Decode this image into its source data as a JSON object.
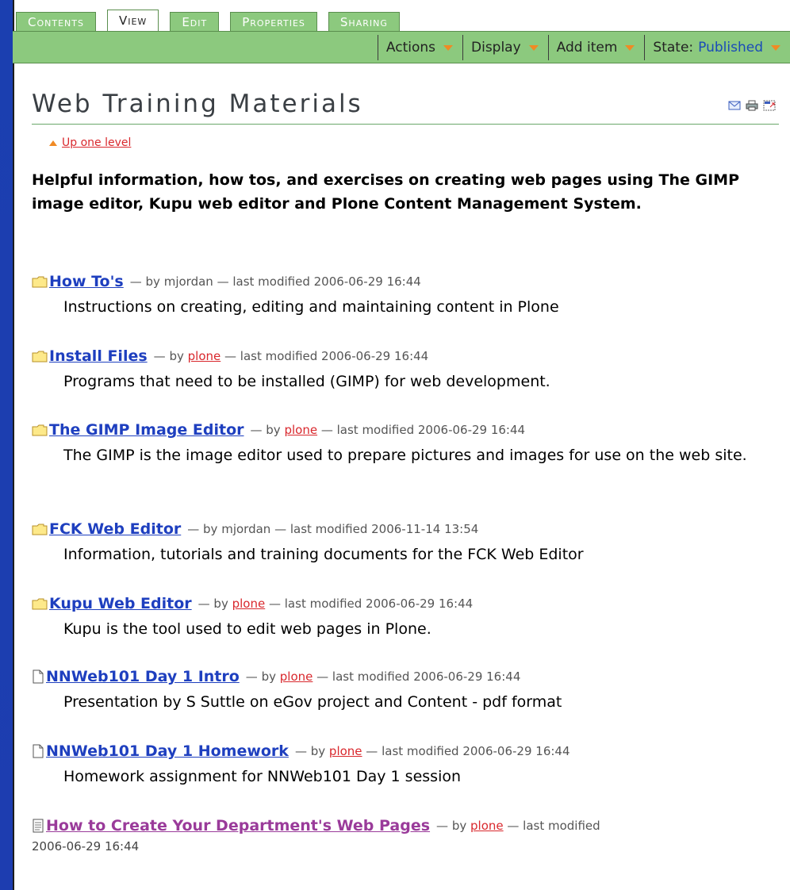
{
  "tabs": [
    "Contents",
    "View",
    "Edit",
    "Properties",
    "Sharing"
  ],
  "active_tab": "View",
  "actions": {
    "actions_label": "Actions",
    "display_label": "Display",
    "add_item_label": "Add item",
    "state_label": "State:",
    "state_value": "Published"
  },
  "page": {
    "title": "Web Training Materials",
    "up_one_level": "Up one level",
    "description": "Helpful information, how tos, and exercises on creating web pages using The GIMP image editor, Kupu web editor and Plone Content Management System."
  },
  "items": [
    {
      "icon": "folder-icon",
      "title": "How To's",
      "by": "by",
      "author": "mjordan",
      "author_link": false,
      "modified": "last modified 2006-06-29 16:44",
      "desc": "Instructions on creating, editing and maintaining content in Plone"
    },
    {
      "icon": "folder-icon",
      "title": "Install Files",
      "by": "by",
      "author": "plone",
      "author_link": true,
      "modified": "last modified 2006-06-29 16:44",
      "desc": "Programs that need to be installed (GIMP) for web development."
    },
    {
      "icon": "folder-icon",
      "title": "The GIMP Image Editor",
      "by": "by",
      "author": "plone",
      "author_link": true,
      "modified": "last modified 2006-06-29 16:44",
      "desc": "The GIMP is the image editor used to prepare pictures and images for use on the web site."
    },
    {
      "icon": "folder-icon",
      "title": "FCK Web Editor",
      "by": "by",
      "author": "mjordan",
      "author_link": false,
      "modified": "last modified 2006-11-14 13:54",
      "desc": "Information, tutorials and training documents for the FCK Web Editor"
    },
    {
      "icon": "folder-icon",
      "title": "Kupu Web Editor",
      "by": "by",
      "author": "plone",
      "author_link": true,
      "modified": "last modified 2006-06-29 16:44",
      "desc": "Kupu is the tool used to edit web pages in Plone."
    },
    {
      "icon": "file-icon",
      "title": "NNWeb101 Day 1 Intro",
      "by": "by",
      "author": "plone",
      "author_link": true,
      "modified": "last modified 2006-06-29 16:44",
      "desc": "Presentation by S Suttle on eGov project and Content - pdf format"
    },
    {
      "icon": "file-icon",
      "title": "NNWeb101 Day 1 Homework",
      "by": "by",
      "author": "plone",
      "author_link": true,
      "modified": "last modified 2006-06-29 16:44",
      "desc": "Homework assignment for NNWeb101 Day 1 session"
    },
    {
      "icon": "document-icon",
      "title": "How to Create Your Department's Web Pages",
      "by": "by",
      "author": "plone",
      "author_link": true,
      "modified": "last modified",
      "modified2": "2006-06-29 16:44",
      "desc": ""
    }
  ],
  "colors": {
    "accent_green": "#8cc97e",
    "link_blue": "#1e3fbf",
    "author_red": "#d9282d",
    "visited": "#9a3b9a",
    "bg_blue": "#1d3db0"
  }
}
